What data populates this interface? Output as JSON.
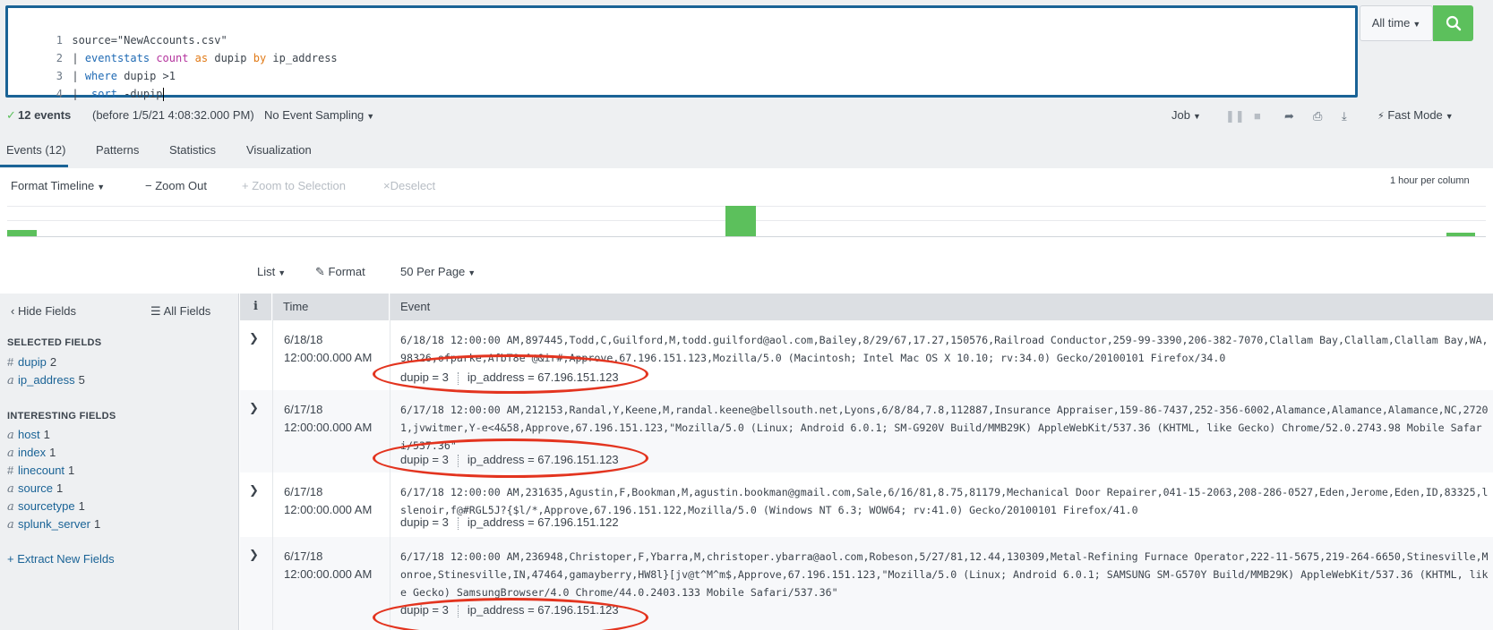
{
  "search": {
    "lines": [
      {
        "num": "1",
        "text": "source=\"NewAccounts.csv\""
      },
      {
        "num": "2",
        "pipe": "|",
        "cmd": "eventstats",
        "fn": "count",
        "kw1": "as",
        "arg1": "dupip",
        "kw2": "by",
        "arg2": "ip_address"
      },
      {
        "num": "3",
        "pipe": "|",
        "cmd": "where",
        "arg1": "dupip >1"
      },
      {
        "num": "4",
        "pipe": "|",
        "cmd": "sort",
        "arg1": "-dupip"
      }
    ],
    "time_range": "All time"
  },
  "status": {
    "check": "✓",
    "event_count": "12 events",
    "before": "(before 1/5/21 4:08:32.000 PM)",
    "sampling": "No Event Sampling",
    "job": "Job",
    "mode": "Fast Mode"
  },
  "tabs": [
    "Events (12)",
    "Patterns",
    "Statistics",
    "Visualization"
  ],
  "timeline": {
    "format": "Format Timeline",
    "zoom_out": "Zoom Out",
    "zoom_selection": "Zoom to Selection",
    "deselect": "Deselect",
    "scale": "1 hour per column",
    "accent": "#5cc05c"
  },
  "results_toolbar": {
    "list": "List",
    "format": "Format",
    "per_page": "50 Per Page"
  },
  "sidebar": {
    "hide_fields": "Hide Fields",
    "all_fields": "All Fields",
    "selected_heading": "SELECTED FIELDS",
    "selected": [
      {
        "type": "#",
        "name": "dupip",
        "count": "2"
      },
      {
        "type": "a",
        "name": "ip_address",
        "count": "5"
      }
    ],
    "interesting_heading": "INTERESTING FIELDS",
    "interesting": [
      {
        "type": "a",
        "name": "host",
        "count": "1"
      },
      {
        "type": "a",
        "name": "index",
        "count": "1"
      },
      {
        "type": "#",
        "name": "linecount",
        "count": "1"
      },
      {
        "type": "a",
        "name": "source",
        "count": "1"
      },
      {
        "type": "a",
        "name": "sourcetype",
        "count": "1"
      },
      {
        "type": "a",
        "name": "splunk_server",
        "count": "1"
      }
    ],
    "extract": "+ Extract New Fields"
  },
  "table": {
    "headers": {
      "info": "i",
      "time": "Time",
      "event": "Event"
    },
    "rows": [
      {
        "date": "6/18/18",
        "time": "12:00:00.000 AM",
        "event": "6/18/18 12:00:00 AM,897445,Todd,C,Guilford,M,todd.guilford@aol.com,Bailey,8/29/67,17.27,150576,Railroad Conductor,259-99-3390,206-382-7070,Clallam Bay,Clallam,Clallam Bay,WA,98326,ofparke,AfbT8e^@&ir#,Approve,67.196.151.123,Mozilla/5.0 (Macintosh; Intel Mac OS X 10.10; rv:34.0) Gecko/20100101 Firefox/34.0",
        "dupip": "dupip = 3",
        "ip": "ip_address = 67.196.151.123"
      },
      {
        "date": "6/17/18",
        "time": "12:00:00.000 AM",
        "event": "6/17/18 12:00:00 AM,212153,Randal,Y,Keene,M,randal.keene@bellsouth.net,Lyons,6/8/84,7.8,112887,Insurance Appraiser,159-86-7437,252-356-6002,Alamance,Alamance,Alamance,NC,27201,jvwitmer,Y-e<4&58,Approve,67.196.151.123,\"Mozilla/5.0 (Linux; Android 6.0.1; SM-G920V Build/MMB29K) AppleWebKit/537.36 (KHTML, like Gecko) Chrome/52.0.2743.98 Mobile Safari/537.36\"",
        "dupip": "dupip = 3",
        "ip": "ip_address = 67.196.151.123"
      },
      {
        "date": "6/17/18",
        "time": "12:00:00.000 AM",
        "event": "6/17/18 12:00:00 AM,231635,Agustin,F,Bookman,M,agustin.bookman@gmail.com,Sale,6/16/81,8.75,81179,Mechanical Door Repairer,041-15-2063,208-286-0527,Eden,Jerome,Eden,ID,83325,lslenoir,f@#RGL5J?{$l/*,Approve,67.196.151.122,Mozilla/5.0 (Windows NT 6.3; WOW64; rv:41.0) Gecko/20100101 Firefox/41.0",
        "dupip": "dupip = 3",
        "ip": "ip_address = 67.196.151.122"
      },
      {
        "date": "6/17/18",
        "time": "12:00:00.000 AM",
        "event": "6/17/18 12:00:00 AM,236948,Christoper,F,Ybarra,M,christoper.ybarra@aol.com,Robeson,5/27/81,12.44,130309,Metal-Refining Furnace Operator,222-11-5675,219-264-6650,Stinesville,Monroe,Stinesville,IN,47464,gamayberry,HW8l}[jv@t^M^m$,Approve,67.196.151.123,\"Mozilla/5.0 (Linux; Android 6.0.1; SAMSUNG SM-G570Y Build/MMB29K) AppleWebKit/537.36 (KHTML, like Gecko) SamsungBrowser/4.0 Chrome/44.0.2403.133 Mobile Safari/537.36\"",
        "dupip": "dupip = 3",
        "ip": "ip_address = 67.196.151.123"
      }
    ]
  },
  "highlight_color": "#e3341f"
}
